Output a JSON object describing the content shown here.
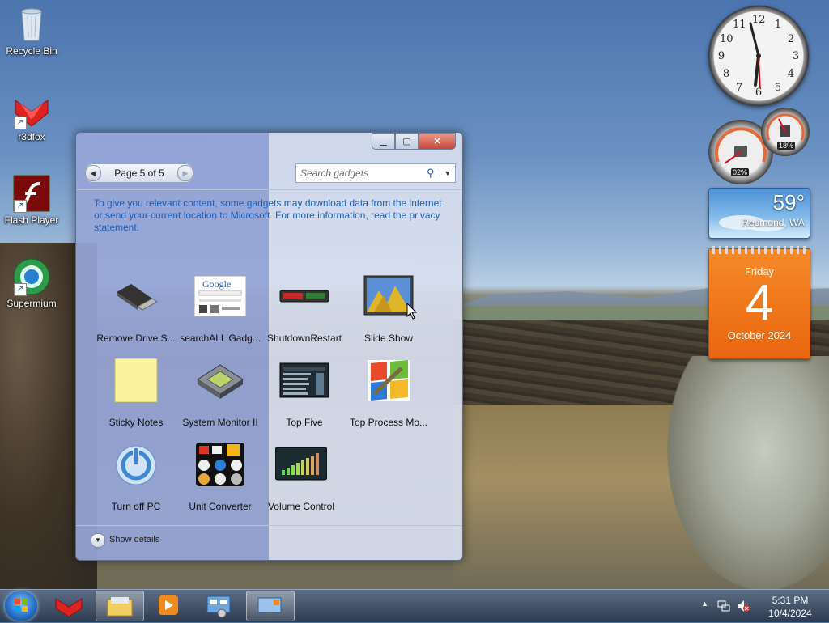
{
  "desktop": {
    "icons": [
      {
        "label": "Recycle Bin",
        "icon": "recycle-bin-icon"
      },
      {
        "label": "r3dfox",
        "icon": "r3dfox-icon"
      },
      {
        "label": "Flash Player",
        "icon": "flash-player-icon"
      },
      {
        "label": "Supermium",
        "icon": "supermium-icon"
      }
    ]
  },
  "gallery": {
    "pager": {
      "text": "Page 5 of 5"
    },
    "search": {
      "placeholder": "Search gadgets"
    },
    "notice": "To give you relevant content, some gadgets may download data from the internet or send your current location to Microsoft. For more information, read the privacy statement.",
    "gadgets": [
      {
        "label": "Remove Drive S...",
        "icon": "usb-drive-icon"
      },
      {
        "label": "searchALL Gadg...",
        "icon": "google-search-icon"
      },
      {
        "label": "ShutdownRestart",
        "icon": "shutdown-restart-icon"
      },
      {
        "label": "Slide Show",
        "icon": "slide-show-icon"
      },
      {
        "label": "Sticky Notes",
        "icon": "sticky-note-icon"
      },
      {
        "label": "System Monitor II",
        "icon": "chip-icon"
      },
      {
        "label": "Top Five",
        "icon": "top-five-icon"
      },
      {
        "label": "Top Process Mo...",
        "icon": "top-process-icon"
      },
      {
        "label": "Turn off PC",
        "icon": "power-icon"
      },
      {
        "label": "Unit Converter",
        "icon": "unit-converter-icon"
      },
      {
        "label": "Volume Control",
        "icon": "volume-control-icon"
      }
    ],
    "details": {
      "label": "Show details"
    }
  },
  "sidebar": {
    "clock": {
      "numbers": [
        "12",
        "1",
        "2",
        "3",
        "4",
        "5",
        "6",
        "7",
        "8",
        "9",
        "10",
        "11"
      ]
    },
    "cpu": {
      "cpu_percent": "02%",
      "mem_percent": "18%"
    },
    "weather": {
      "temp": "59°",
      "city": "Redmond, WA"
    },
    "calendar": {
      "weekday": "Friday",
      "day": "4",
      "month": "October 2024"
    }
  },
  "taskbar": {
    "time": "5:31 PM",
    "date": "10/4/2024"
  },
  "colors": {
    "accent": "#1e5fb8",
    "calendar": "#f07a1c"
  }
}
